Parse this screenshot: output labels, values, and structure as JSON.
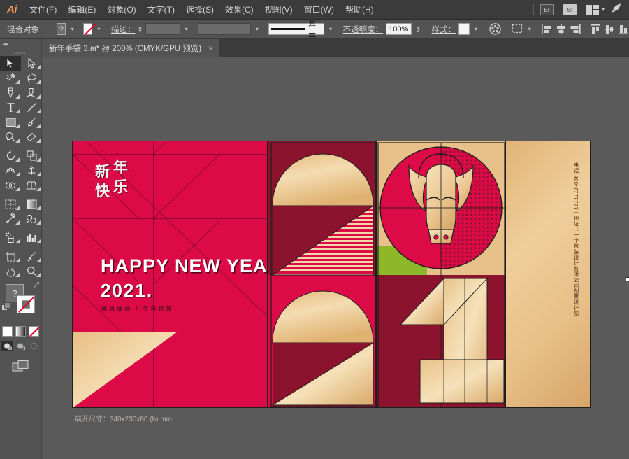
{
  "app": {
    "name": "Adobe Illustrator",
    "logo_text": "Ai"
  },
  "menubar": {
    "items": [
      {
        "label": "文件(F)",
        "name": "menu-file"
      },
      {
        "label": "编辑(E)",
        "name": "menu-edit"
      },
      {
        "label": "对象(O)",
        "name": "menu-object"
      },
      {
        "label": "文字(T)",
        "name": "menu-type"
      },
      {
        "label": "选择(S)",
        "name": "menu-select"
      },
      {
        "label": "效果(C)",
        "name": "menu-effect"
      },
      {
        "label": "视图(V)",
        "name": "menu-view"
      },
      {
        "label": "窗口(W)",
        "name": "menu-window"
      },
      {
        "label": "帮助(H)",
        "name": "menu-help"
      }
    ],
    "bridge_label": "Br",
    "stock_label": "St",
    "arrange_icon": "arrange-documents-icon",
    "search_icon": "discover-rocket-icon"
  },
  "controlbar": {
    "selection_label": "混合对象",
    "fill_swatch_label": "?",
    "stroke_label": "描边：",
    "stroke_weight_value": "",
    "brush_label": "基本",
    "opacity_label": "不透明度：",
    "opacity_value": "100%",
    "style_label": "样式：",
    "recolor_icon": "recolor-artwork-icon",
    "select_similar_icon": "select-similar-icon",
    "align_icons": [
      "align-left-icon",
      "align-center-h-icon",
      "align-right-icon",
      "align-top-icon",
      "align-center-v-icon",
      "align-bottom-icon"
    ]
  },
  "tab": {
    "title": "新年手袋 3.ai* @ 200% (CMYK/GPU 预览)",
    "close_label": "×"
  },
  "toolbar": {
    "tools": [
      {
        "name": "selection-tool",
        "selected": true
      },
      {
        "name": "direct-selection-tool",
        "selected": false
      },
      {
        "name": "magic-wand-tool",
        "selected": false
      },
      {
        "name": "lasso-tool",
        "selected": false
      },
      {
        "name": "pen-tool",
        "selected": false
      },
      {
        "name": "curvature-tool",
        "selected": false
      },
      {
        "name": "type-tool",
        "selected": false
      },
      {
        "name": "line-segment-tool",
        "selected": false
      },
      {
        "name": "rectangle-tool",
        "selected": false
      },
      {
        "name": "paintbrush-tool",
        "selected": false
      },
      {
        "name": "shaper-tool",
        "selected": false
      },
      {
        "name": "eraser-tool",
        "selected": false
      },
      {
        "name": "rotate-tool",
        "selected": false
      },
      {
        "name": "scale-tool",
        "selected": false
      },
      {
        "name": "width-tool",
        "selected": false
      },
      {
        "name": "free-transform-tool",
        "selected": false
      },
      {
        "name": "shape-builder-tool",
        "selected": false
      },
      {
        "name": "perspective-grid-tool",
        "selected": false
      },
      {
        "name": "mesh-tool",
        "selected": false
      },
      {
        "name": "gradient-tool",
        "selected": false
      },
      {
        "name": "eyedropper-tool",
        "selected": false
      },
      {
        "name": "blend-tool",
        "selected": false
      },
      {
        "name": "symbol-sprayer-tool",
        "selected": false
      },
      {
        "name": "column-graph-tool",
        "selected": false
      },
      {
        "name": "artboard-tool",
        "selected": false
      },
      {
        "name": "slice-tool",
        "selected": false
      },
      {
        "name": "hand-tool",
        "selected": false
      },
      {
        "name": "zoom-tool",
        "selected": false
      }
    ],
    "fill_label": "?",
    "color_button": "color-fill-button",
    "gradient_button": "gradient-fill-button",
    "none_button": "none-fill-button",
    "draw_normal": "draw-normal-button",
    "draw_behind": "draw-behind-button",
    "draw_inside": "draw-inside-button",
    "screen_mode": "change-screen-mode-button"
  },
  "artwork": {
    "greeting_cn": [
      "新",
      "年",
      "快",
      "乐"
    ],
    "headline": "HAPPY NEW YEAR!",
    "year": "2021.",
    "subtitle": "国风插画 / 牛年包装",
    "vertical_text": "电话 400-7777777  |  地址：一个包装设计有限公司创意设计部",
    "dimensions_note": "展开尺寸：340x230x80 (h) mm",
    "colors": {
      "crimson": "#DC0A46",
      "dark_red": "#8C132E",
      "gold_light": "#F2D7A8",
      "gold_mid": "#E5B777",
      "gold_dark": "#C79B5F",
      "green": "#8CB829",
      "outline": "#1E1E1E",
      "handle": "#141414"
    }
  },
  "chrome": {
    "bg_app": "#535353",
    "bg_menu": "#3b3b3b",
    "bg_canvas": "#5a5a5a",
    "accent": "#f89c5b"
  }
}
